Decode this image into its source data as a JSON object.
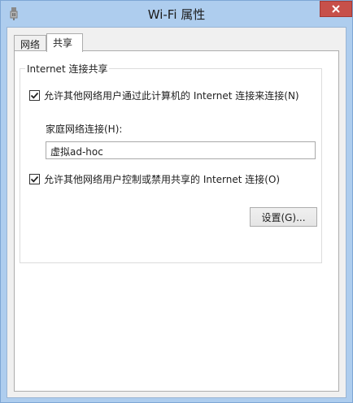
{
  "window": {
    "title": "Wi-Fi 属性",
    "close_label": "×"
  },
  "tabs": [
    {
      "label": "网络",
      "active": false
    },
    {
      "label": "共享",
      "active": true
    }
  ],
  "sharing": {
    "group_title": "Internet 连接共享",
    "allow_connect": {
      "label": "允许其他网络用户通过此计算机的 Internet 连接来连接(N)",
      "checked": true
    },
    "home_network": {
      "label": "家庭网络连接(H):",
      "value": "虚拟ad-hoc"
    },
    "allow_control": {
      "label": "允许其他网络用户控制或禁用共享的 Internet 连接(O)",
      "checked": true
    },
    "settings_button": "设置(G)..."
  },
  "colors": {
    "frame": "#aecdee",
    "close": "#c7504a"
  }
}
